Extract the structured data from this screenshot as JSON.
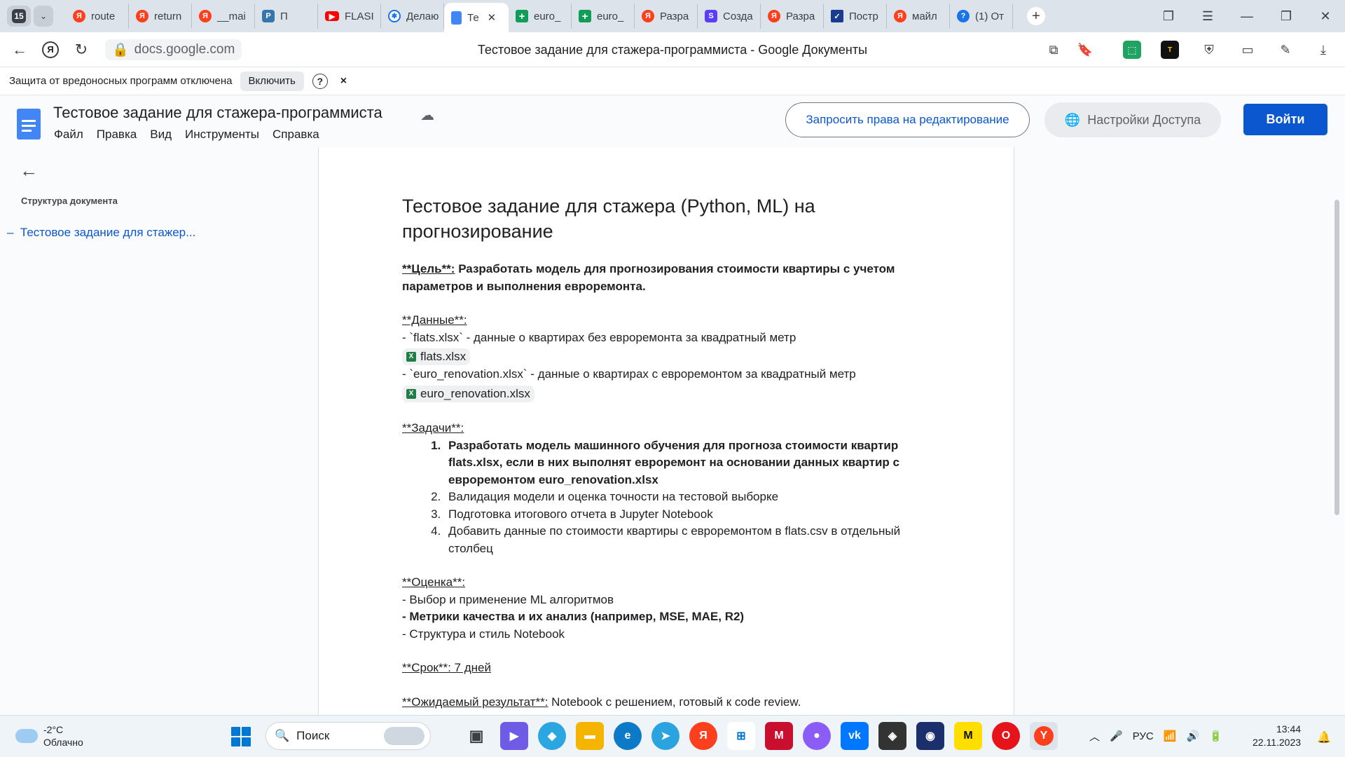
{
  "browser": {
    "tab_count": "15",
    "tabs": [
      {
        "label": "route",
        "icon": "yandex-icon"
      },
      {
        "label": "return",
        "icon": "yandex-icon"
      },
      {
        "label": "__mai",
        "icon": "yandex-icon"
      },
      {
        "label": "П",
        "icon": "python-icon"
      },
      {
        "label": "FLASI",
        "icon": "youtube-icon"
      },
      {
        "label": "Делаю",
        "icon": "gear-icon"
      },
      {
        "label": "Те",
        "icon": "google-docs-icon",
        "active": true
      },
      {
        "label": "euro_",
        "icon": "google-sheets-icon"
      },
      {
        "label": "euro_",
        "icon": "google-sheets-icon"
      },
      {
        "label": "Разра",
        "icon": "yandex-icon"
      },
      {
        "label": "Созда",
        "icon": "s-icon"
      },
      {
        "label": "Разра",
        "icon": "yandex-icon"
      },
      {
        "label": "Постр",
        "icon": "check-icon"
      },
      {
        "label": "майл",
        "icon": "yandex-icon"
      },
      {
        "label": "(1) От",
        "icon": "question-icon"
      }
    ],
    "url": "docs.google.com",
    "page_title": "Тестовое задание для стажера-программиста - Google Документы"
  },
  "security_bar": {
    "message": "Защита от вредоносных программ отключена",
    "enable_label": "Включить",
    "help": "?",
    "close": "×"
  },
  "docs": {
    "title": "Тестовое задание для стажера-программиста",
    "menu": [
      "Файл",
      "Правка",
      "Вид",
      "Инструменты",
      "Справка"
    ],
    "request_edit_label": "Запросить права на редактирование",
    "access_settings_label": "Настройки Доступа",
    "login_label": "Войти"
  },
  "outline": {
    "label": "Структура документа",
    "items": [
      "Тестовое задание для стажер..."
    ]
  },
  "document": {
    "heading": "Тестовое задание для стажера (Python, ML) на прогнозирование",
    "goal_label": "**Цель**:",
    "goal_text": " Разработать модель для прогнозирования стоимости квартиры с учетом параметров и выполнения евроремонта.",
    "data_label": "**Данные**:",
    "data_line1": "- `flats.xlsx` - данные о квартирах без евроремонта за квадратный метр",
    "file1": "flats.xlsx",
    "data_line2": "- `euro_renovation.xlsx` - данные о квартирах с евроремонтом за квадратный метр",
    "file2": "euro_renovation.xlsx",
    "tasks_label": "**Задачи**:",
    "tasks": [
      "Разработать модель машинного обучения для прогноза стоимости квартир flats.xlsx, если в них выполнят евроремонт на основании данных квартир с евроремонтом euro_renovation.xlsx",
      "Валидация модели и оценка точности на тестовой выборке",
      "Подготовка итогового отчета в Jupyter Notebook",
      "Добавить данные по стоимости квартиры с евроремонтом в flats.csv в отдельный столбец"
    ],
    "eval_label": "**Оценка**:",
    "eval_items": [
      "- Выбор и применение ML алгоритмов",
      "- Метрики качества и их анализ (например, MSE, MAE, R2)",
      "- Структура и стиль Notebook"
    ],
    "deadline": "**Срок**: 7 дней",
    "result_label": "**Ожидаемый результат**:",
    "result_text": " Notebook с решением, готовый к code review."
  },
  "taskbar": {
    "temperature": "-2°C",
    "weather": "Облачно",
    "search_placeholder": "Поиск",
    "language": "РУС",
    "time": "13:44",
    "date": "22.11.2023"
  },
  "colors": {
    "accent": "#0b57d0",
    "docs_blue": "#4285f4",
    "sheets_green": "#1e7e45"
  }
}
